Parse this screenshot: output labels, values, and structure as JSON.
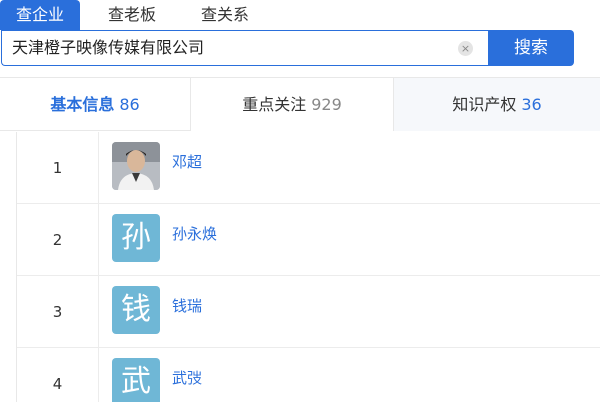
{
  "search_tabs": [
    {
      "label": "查企业"
    },
    {
      "label": "查老板"
    },
    {
      "label": "查关系"
    }
  ],
  "search": {
    "value": "天津橙子映像传媒有限公司",
    "clear_symbol": "×",
    "button_label": "搜索"
  },
  "stat_tabs": [
    {
      "label": "基本信息",
      "count": "86"
    },
    {
      "label": "重点关注",
      "count": "929"
    },
    {
      "label": "知识产权",
      "count": "36"
    }
  ],
  "people": [
    {
      "index": "1",
      "name": "邓超",
      "avatar_char": ""
    },
    {
      "index": "2",
      "name": "孙永焕",
      "avatar_char": "孙"
    },
    {
      "index": "3",
      "name": "钱瑞",
      "avatar_char": "钱"
    },
    {
      "index": "4",
      "name": "武弢",
      "avatar_char": "武"
    }
  ],
  "colors": {
    "accent": "#2a6fdb",
    "avatar_bg": "#6fb7d6"
  }
}
